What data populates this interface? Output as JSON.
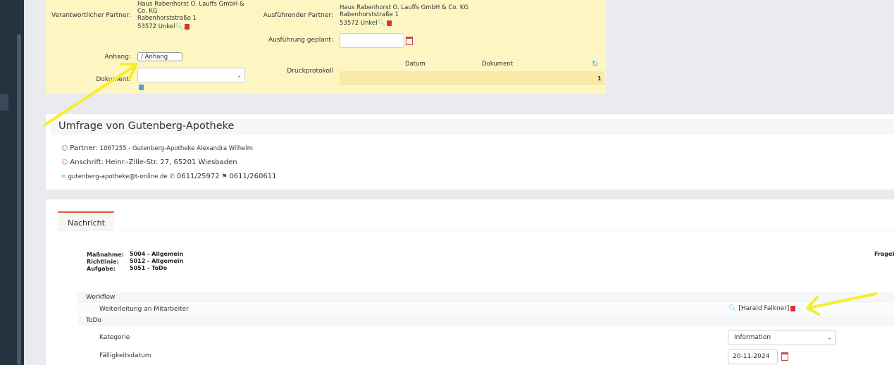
{
  "top_form": {
    "responsible_label": "Verantwortlicher Partner:",
    "responsible_line1": "Haus Rabenhorst O. Lauffs GmbH &",
    "responsible_line2": "Co. KG",
    "responsible_line3": "Rabenhorststraße 1",
    "responsible_line4": "53572 Unkel",
    "executing_label": "Ausführender Partner:",
    "executing_line1": "Haus Rabenhorst O. Lauffs GmbH & Co. KG",
    "executing_line2": "Rabenhorststraße 1",
    "executing_line3": "53572 Unkel",
    "planned_label": "Ausführung geplant:",
    "planned_value": "",
    "attachment_label": "Anhang:",
    "attachment_button": "Anhang",
    "document_label": "Dokument:",
    "document_value": "",
    "print_label": "Druckprotokoll",
    "print_col_date": "Datum",
    "print_col_doc": "Dokument",
    "print_row_count": "1"
  },
  "survey": {
    "title": "Umfrage von Gutenberg-Apotheke",
    "partner_label": "Partner:",
    "partner_value": "1067255 - Gutenberg-Apotheke Alexandra Wilhelm",
    "address_label": "Anschrift:",
    "address_value": "Heinr.-Zille-Str. 27, 65201 Wiesbaden",
    "email": "gutenberg-apotheke@t-online.de",
    "phone": "0611/25972",
    "fax": "0611/260611"
  },
  "message": {
    "tab_label": "Nachricht",
    "measure_label": "Maßnahme:",
    "measure_value": "5004 - Allgemein",
    "guideline_label": "Richtlinie:",
    "guideline_value": "5012 - Allgemein",
    "task_label": "Aufgabe:",
    "task_value": "5051 - ToDo",
    "right_truncated": "Frageb",
    "workflow_label": "Workflow",
    "forward_label": "Weiterleitung an Mitarbeiter",
    "forward_value": "[Harald Falkner]",
    "todo_label": "ToDo",
    "category_label": "Kategorie",
    "category_value": "Information",
    "due_label": "Fälligkeitsdatum",
    "due_value": "20-11-2024"
  },
  "colors": {
    "form_bg": "#fdf6c3",
    "sidebar": "#253341",
    "tab_accent": "#e0593b",
    "annotation_arrow": "#f7ee2a"
  }
}
